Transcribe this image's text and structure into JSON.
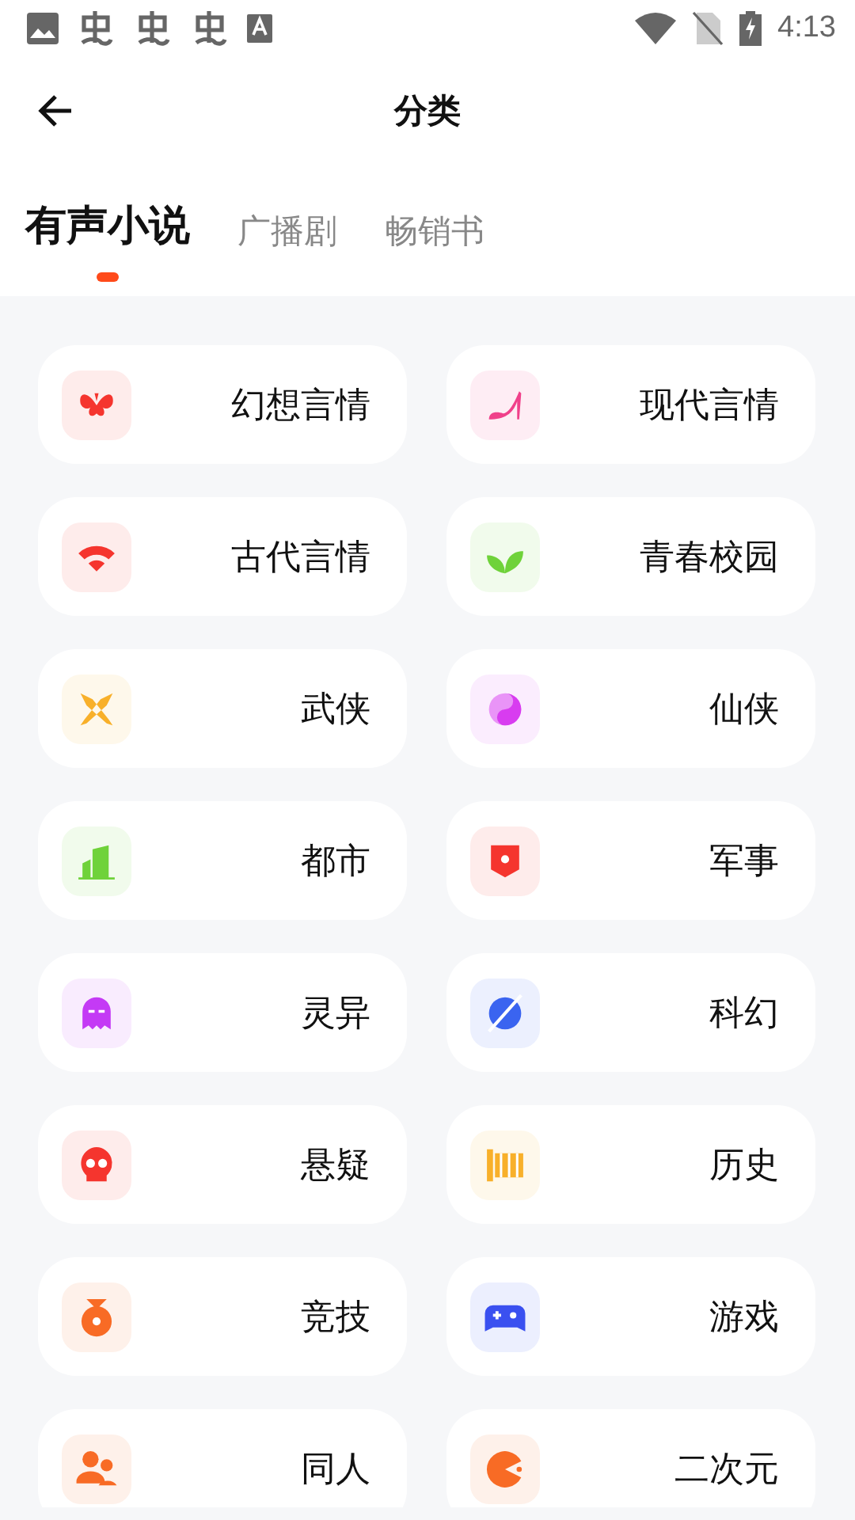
{
  "status_bar": {
    "time": "4:13"
  },
  "header": {
    "title": "分类"
  },
  "tabs": [
    {
      "label": "有声小说",
      "selected": true
    },
    {
      "label": "广播剧",
      "selected": false
    },
    {
      "label": "畅销书",
      "selected": false
    }
  ],
  "categories": [
    {
      "label": "幻想言情",
      "color": "#f5352e"
    },
    {
      "label": "现代言情",
      "color": "#f0408a"
    },
    {
      "label": "古代言情",
      "color": "#f5352e"
    },
    {
      "label": "青春校园",
      "color": "#6fd23a"
    },
    {
      "label": "武侠",
      "color": "#f8b02a"
    },
    {
      "label": "仙侠",
      "color": "#d83cf0"
    },
    {
      "label": "都市",
      "color": "#6fd23a"
    },
    {
      "label": "军事",
      "color": "#f5352e"
    },
    {
      "label": "灵异",
      "color": "#c43af5"
    },
    {
      "label": "科幻",
      "color": "#3a64f0"
    },
    {
      "label": "悬疑",
      "color": "#f5352e"
    },
    {
      "label": "历史",
      "color": "#f8b02a"
    },
    {
      "label": "竞技",
      "color": "#f86b25"
    },
    {
      "label": "游戏",
      "color": "#3a50f0"
    },
    {
      "label": "同人",
      "color": "#f86b25"
    },
    {
      "label": "二次元",
      "color": "#f86b25"
    }
  ]
}
